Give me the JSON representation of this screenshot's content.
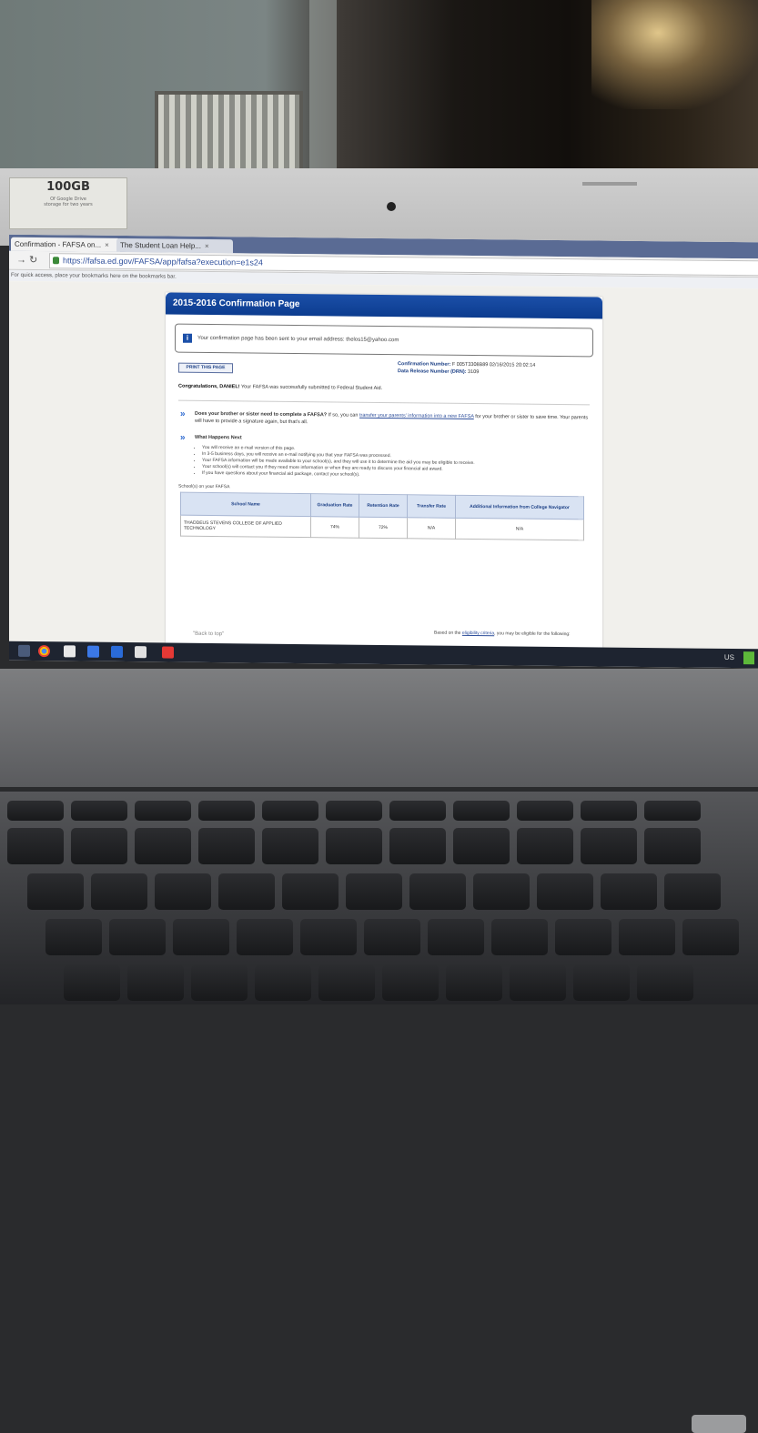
{
  "photo": {
    "sticker": {
      "title": "100GB",
      "lines": [
        "Of Google Drive",
        "storage for two years"
      ]
    }
  },
  "browser": {
    "tabs": [
      {
        "label": "Confirmation - FAFSA on...",
        "active": true
      },
      {
        "label": "The Student Loan Help..."
      }
    ],
    "url": "https://fafsa.ed.gov/FAFSA/app/fafsa?execution=e1s24",
    "bookmarks_hint": "For quick access, place your bookmarks here on the bookmarks bar."
  },
  "page": {
    "header_title": "2015-2016 Confirmation Page",
    "notice_text": "Your confirmation page has been sent to your email address: thelos15@yahoo.com",
    "print_button": "PRINT THIS PAGE",
    "confirmation_label": "Confirmation Number:",
    "confirmation_value": "F 005T3308B89 02/16/2015 20:02:14",
    "release_label": "Data Release Number (DRN):",
    "release_value": "3109",
    "congrats_name": "Congratulations, DANIEL!",
    "congrats_text": "Your FAFSA was successfully submitted to Federal Student Aid.",
    "sibling_question": "Does your brother or sister need to complete a FAFSA?",
    "sibling_text": "If so, you can",
    "sibling_link": "transfer your parents' information into a new FAFSA",
    "sibling_text2": "for your brother or sister to save time. Your parents will have to provide a signature again, but that's all.",
    "next_heading": "What Happens Next",
    "next_items": [
      "You will receive an e-mail version of this page.",
      "In 3-5 business days, you will receive an e-mail notifying you that your FAFSA was processed.",
      "Your FAFSA information will be made available to your school(s), and they will use it to determine the aid you may be eligible to receive.",
      "Your school(s) will contact you if they need more information or when they are ready to discuss your financial aid award.",
      "If you have questions about your financial aid package, contact your school(s)."
    ],
    "schools_caption": "School(s) on your FAFSA",
    "table_headers": [
      "School Name",
      "Graduation Rate",
      "Retention Rate",
      "Transfer Rate",
      "Additional Information from College Navigator"
    ],
    "table_rows": [
      [
        "THADDEUS STEVENS COLLEGE OF APPLIED TECHNOLOGY",
        "74%",
        "72%",
        "N/A",
        "N/A"
      ]
    ],
    "bottom_left": "\"Back to top\"",
    "bottom_right_text": "Based on the",
    "bottom_right_link": "eligibility criteria",
    "bottom_right_text2": ", you may be eligible for the following:"
  },
  "taskbar": {
    "status": "US"
  }
}
